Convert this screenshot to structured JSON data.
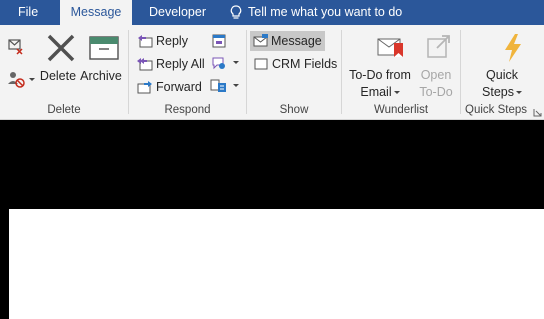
{
  "tabs": {
    "file": "File",
    "message": "Message",
    "developer": "Developer",
    "tell_me": "Tell me what you want to do"
  },
  "groups": {
    "delete": {
      "label": "Delete",
      "delete_button": "Delete",
      "archive_button": "Archive"
    },
    "respond": {
      "label": "Respond",
      "reply": "Reply",
      "reply_all": "Reply All",
      "forward": "Forward"
    },
    "show": {
      "label": "Show",
      "message": "Message",
      "crm_fields": "CRM Fields"
    },
    "wunderlist": {
      "label": "Wunderlist",
      "todo_line1": "To-Do from",
      "todo_line2": "Email",
      "open_line1": "Open",
      "open_line2": "To-Do"
    },
    "quick_steps": {
      "label": "Quick Steps",
      "button_line1": "Quick",
      "button_line2": "Steps"
    }
  },
  "colors": {
    "titlebar": "#2b579a",
    "ribbon": "#f3f3f3"
  }
}
